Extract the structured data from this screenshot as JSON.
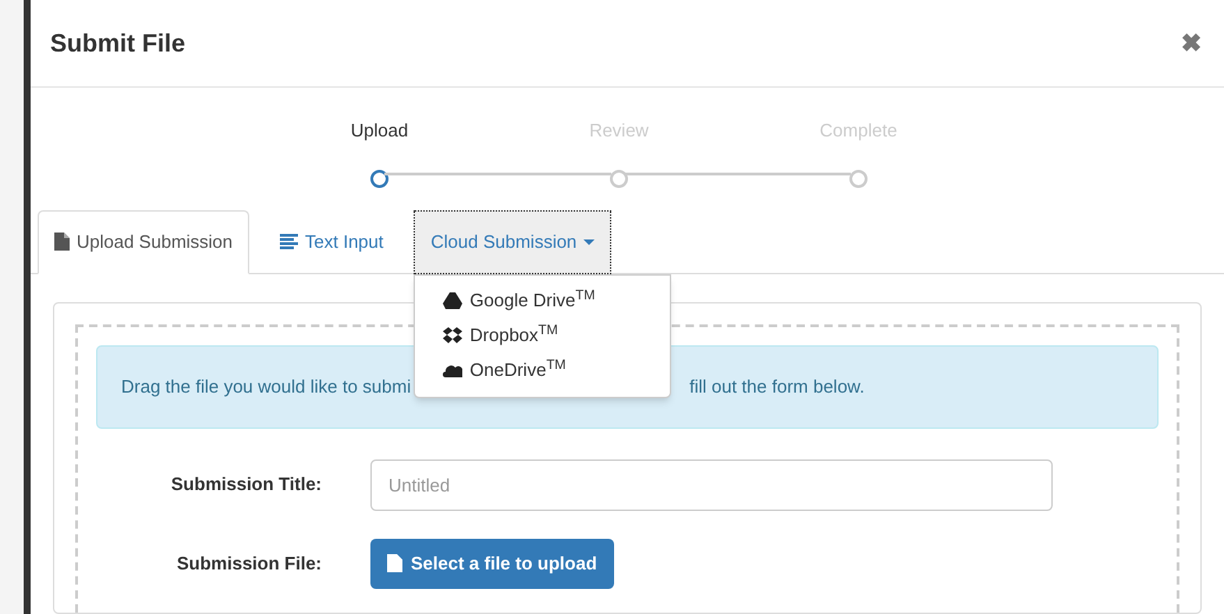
{
  "dialog": {
    "title": "Submit File",
    "close": "✖"
  },
  "steps": [
    {
      "label": "Upload",
      "selected": true
    },
    {
      "label": "Review",
      "selected": false
    },
    {
      "label": "Complete",
      "selected": false
    }
  ],
  "tabs": [
    {
      "label": "Upload Submission",
      "kind": "file",
      "selected": true
    },
    {
      "label": "Text Input",
      "kind": "text",
      "selected": false
    },
    {
      "label": "Cloud Submission",
      "kind": "dropdown",
      "selected": false,
      "expanded": true
    }
  ],
  "cloud_menu": [
    {
      "label": "Google Drive$^{TM}$",
      "kind": "drive"
    },
    {
      "label": "Dropbox$^{TM}$",
      "kind": "dropbox"
    },
    {
      "label": "OneDrive$^{TM}$",
      "kind": "cloud"
    }
  ],
  "alert": {
    "text_visible_left": "Drag the file you would like to submi",
    "text_visible_right": "fill out the form below."
  },
  "form": {
    "title_label": "Submission Title:",
    "title_placeholder": "Untitled",
    "file_label": "Submission File:",
    "file_button": "Select a file to upload"
  }
}
